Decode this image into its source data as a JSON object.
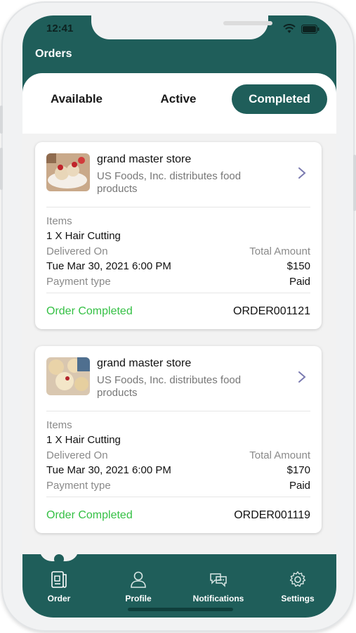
{
  "status_bar": {
    "time": "12:41"
  },
  "header": {
    "title": "Orders"
  },
  "tabs": [
    {
      "label": "Available",
      "active": false
    },
    {
      "label": "Active",
      "active": false
    },
    {
      "label": "Completed",
      "active": true
    }
  ],
  "orders": [
    {
      "store_name": "grand master store",
      "store_desc": "US Foods, Inc. distributes food products",
      "items_label": "Items",
      "items_value": "1 X Hair Cutting",
      "delivered_label": "Delivered On",
      "delivered_value": "Tue Mar 30, 2021 6:00 PM",
      "total_label": "Total Amount",
      "total_value": "$150",
      "payment_label": "Payment type",
      "payment_value": "Paid",
      "status": "Order Completed",
      "order_id": "ORDER001121"
    },
    {
      "store_name": "grand master store",
      "store_desc": "US Foods, Inc. distributes food products",
      "items_label": "Items",
      "items_value": "1 X Hair Cutting",
      "delivered_label": "Delivered On",
      "delivered_value": "Tue Mar 30, 2021 6:00 PM",
      "total_label": "Total Amount",
      "total_value": "$170",
      "payment_label": "Payment type",
      "payment_value": "Paid",
      "status": "Order Completed",
      "order_id": "ORDER001119"
    }
  ],
  "bottom_nav": [
    {
      "label": "Order",
      "icon": "order-icon"
    },
    {
      "label": "Profile",
      "icon": "profile-icon"
    },
    {
      "label": "Notifications",
      "icon": "notifications-icon"
    },
    {
      "label": "Settings",
      "icon": "settings-icon"
    }
  ],
  "colors": {
    "primary": "#1f5e5a",
    "completed": "#34c044",
    "background": "#f2f2f2"
  }
}
